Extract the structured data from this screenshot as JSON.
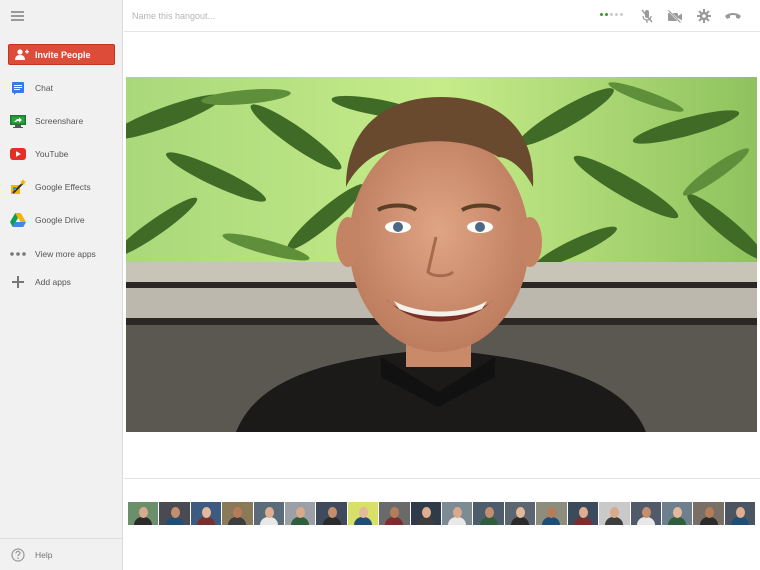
{
  "topbar": {
    "name_placeholder": "Name this hangout...",
    "icons": [
      "signal-strength-icon",
      "mute-microphone-icon",
      "camera-off-icon",
      "settings-gear-icon",
      "hang-up-icon"
    ]
  },
  "sidebar": {
    "invite_label": "Invite People",
    "items": [
      {
        "label": "Chat",
        "icon": "chat-icon"
      },
      {
        "label": "Screenshare",
        "icon": "screenshare-icon"
      },
      {
        "label": "YouTube",
        "icon": "youtube-icon"
      },
      {
        "label": "Google Effects",
        "icon": "google-effects-icon"
      },
      {
        "label": "Google Drive",
        "icon": "google-drive-icon"
      },
      {
        "label": "View more apps",
        "icon": "more-dots-icon"
      },
      {
        "label": "Add apps",
        "icon": "plus-icon"
      }
    ],
    "help_label": "Help"
  },
  "colors": {
    "invite_red": "#dd4b39",
    "signal_green": "#3c9a2c",
    "signal_gray": "#cccccc"
  },
  "participants_count": 20
}
